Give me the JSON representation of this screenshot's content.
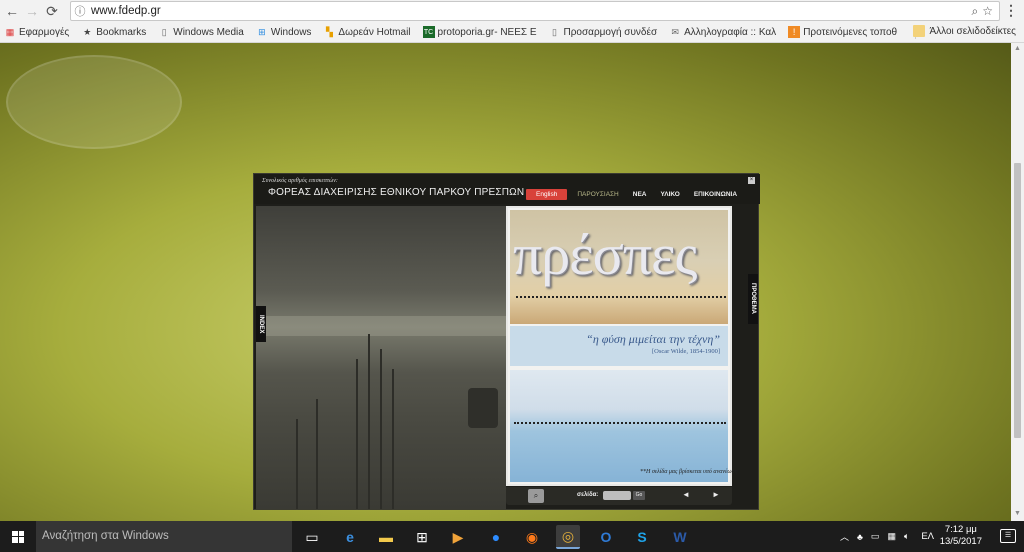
{
  "browser": {
    "url": "www.fdedp.gr",
    "bookmarks": [
      {
        "label": "Εφαρμογές",
        "icon": "apps-grid-icon"
      },
      {
        "label": "Bookmarks",
        "icon": "star-icon"
      },
      {
        "label": "Windows Media",
        "icon": "page-icon"
      },
      {
        "label": "Windows",
        "icon": "windows-icon"
      },
      {
        "label": "Δωρεάν Hotmail",
        "icon": "msn-icon"
      },
      {
        "label": "protoporia.gr- ΝΕΕΣ Ε",
        "icon": "protoporia-icon"
      },
      {
        "label": "Προσαρμογή συνδέσ",
        "icon": "page-icon"
      },
      {
        "label": "Αλληλογραφία :: Καλ",
        "icon": "mail-icon"
      },
      {
        "label": "Προτεινόμενες τοποθ",
        "icon": "suggested-icon"
      }
    ],
    "other_bookmarks": "Άλλοι σελιδοδείκτες"
  },
  "magazine": {
    "small_header": "Συνολικός αριθμός επισκεπτών:",
    "title": "ΦΟΡΕΑΣ ΔΙΑΧΕΙΡΙΣΗΣ ΕΘΝΙΚΟΥ ΠΑΡΚΟΥ ΠΡΕΣΠΩΝ",
    "nav": {
      "english": "English",
      "presentation": "ΠΑΡΟΥΣΙΑΣΗ",
      "news": "ΝΕΑ",
      "material": "ΥΛΙΚΟ",
      "contact": "ΕΠΙΚΟΙΝΩΝΙΑ"
    },
    "index_tab": "INDEX",
    "prothema_tab": "ΠΡΟΘΕΜΑ",
    "cover_word": "πρέσπες",
    "quote": "“η φύση μιμείται την τέχνη”",
    "quote_cite": "[Oscar Wilde, 1854-1900]",
    "page_label": "σελίδα:",
    "page_go": "Go",
    "prev": "◄",
    "next": "►",
    "note": "**Η σελίδα μας βρίσκεται υπό ανανέωση"
  },
  "taskbar": {
    "search_placeholder": "Αναζήτηση στα Windows",
    "language": "ΕΛ",
    "time": "7:12 μμ",
    "date": "13/5/2017"
  }
}
